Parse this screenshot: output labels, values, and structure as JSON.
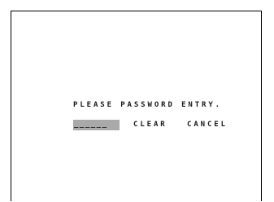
{
  "prompt": {
    "text": "PLEASE PASSWORD ENTRY."
  },
  "password": {
    "value": "______"
  },
  "buttons": {
    "clear_label": "CLEAR",
    "cancel_label": "CANCEL"
  },
  "colors": {
    "background": "#ffffff",
    "text": "#1a1a1a",
    "field_highlight": "#a9a9a9",
    "frame": "#000000"
  }
}
